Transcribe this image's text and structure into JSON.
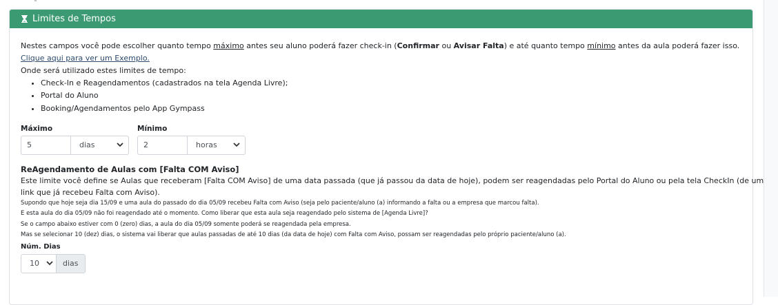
{
  "header": {
    "title": "Limites de Tempos",
    "icon": "hourglass-icon"
  },
  "intro": {
    "part1": "Nestes campos você pode escolher quanto tempo ",
    "maximo": "máximo",
    "part2": " antes seu aluno poderá fazer check-in (",
    "confirmar": "Confirmar",
    "ou": " ou ",
    "avisar": "Avisar Falta",
    "part3": ") e até quanto tempo ",
    "minimo": "mínimo",
    "part4": " antes da aula poderá fazer isso.",
    "link": "Clique aqui para ver um Exemplo.",
    "usage_title": "Onde será utilizado estes limites de tempo:",
    "usage_items": [
      "Check-In e Reagendamentos (cadastrados na tela Agenda Livre);",
      "Portal do Aluno",
      "Booking/Agendamentos pelo App Gympass"
    ]
  },
  "maximo": {
    "label": "Máximo",
    "value": "5",
    "unit": "dias"
  },
  "minimo": {
    "label": "Mínimo",
    "value": "2",
    "unit": "horas"
  },
  "reagendamento": {
    "title": "ReAgendamento de Aulas com [Falta COM Aviso]",
    "desc_line1": "Este limite você define se Aulas que receberam [Falta COM Aviso] de uma data passada (que já passou da data de hoje), podem ser reagendadas pelo Portal do Aluno ou pela tela CheckIn (de um",
    "desc_line2": "link que já recebeu Falta com Aviso).",
    "notes": [
      "Supondo que hoje seja dia 15/09 e uma aula do passado do dia 05/09 recebeu Falta com Aviso (seja pelo paciente/aluno (a) informando a falta ou a empresa que marcou falta).",
      "E esta aula do dia 05/09 não foi reagendado até o momento. Como liberar que esta aula seja reagendado pelo sistema de [Agenda Livre]?",
      "Se o campo abaixo estiver com 0 (zero) dias, a aula do dia 05/09 somente poderá se reagendada pela empresa.",
      "Mas se selecionar 10 (dez) dias, o sistema vai liberar que aulas passadas de até 10 dias (da data de hoje) com Falta com Aviso, possam ser reagendadas pelo próprio paciente/aluno (a)."
    ],
    "num_dias_label": "Núm. Dias",
    "num_dias_value": "10",
    "num_dias_unit": "dias"
  },
  "colors": {
    "header_bg": "#3c9a72",
    "link": "#2b4a6b"
  }
}
